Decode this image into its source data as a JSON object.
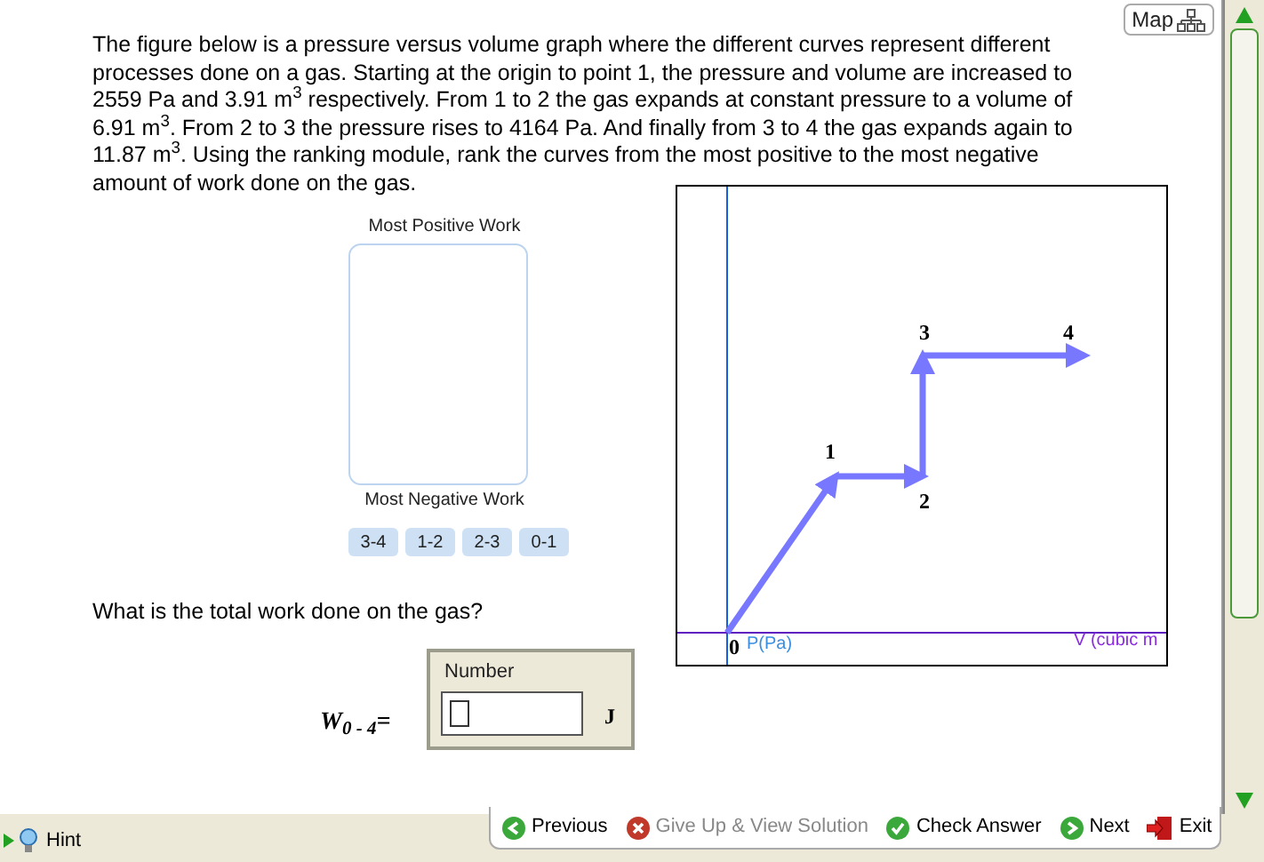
{
  "map_button": {
    "label": "Map"
  },
  "problem": {
    "text": "The figure below is a pressure versus volume graph where the different curves represent different processes done on a gas. Starting at the origin to point 1, the pressure and volume are increased to 2559 Pa and 3.91 m$^{3}$ respectively. From 1 to 2 the gas expands at constant pressure to a volume of 6.91 m$^{3}$. From 2 to 3 the pressure rises to 4164 Pa. And finally from 3 to 4 the gas expands again to 11.87 m$^{3}$. Using the ranking module, rank the curves from the most positive to the most negative amount of work done on the gas."
  },
  "ranking": {
    "top_label": "Most Positive Work",
    "bottom_label": "Most Negative Work",
    "items": [
      "3-4",
      "1-2",
      "2-3",
      "0-1"
    ]
  },
  "graph": {
    "point_labels": [
      "0",
      "1",
      "2",
      "3",
      "4"
    ],
    "y_axis_label": "P(Pa)",
    "x_axis_label": "V (cubic m"
  },
  "question": {
    "text": "What is the total work done on the gas?",
    "variable": "W$_{0 - 4}$=",
    "field_label": "Number",
    "unit": "J"
  },
  "footer": {
    "buttons": [
      {
        "kind": "previous",
        "label": "Previous",
        "disabled": false
      },
      {
        "kind": "giveup",
        "label": "Give Up & View Solution",
        "disabled": true
      },
      {
        "kind": "check",
        "label": "Check Answer",
        "disabled": false
      },
      {
        "kind": "next",
        "label": "Next",
        "disabled": false
      },
      {
        "kind": "exit",
        "label": "Exit",
        "disabled": false
      }
    ],
    "hint": {
      "label": "Hint"
    }
  }
}
